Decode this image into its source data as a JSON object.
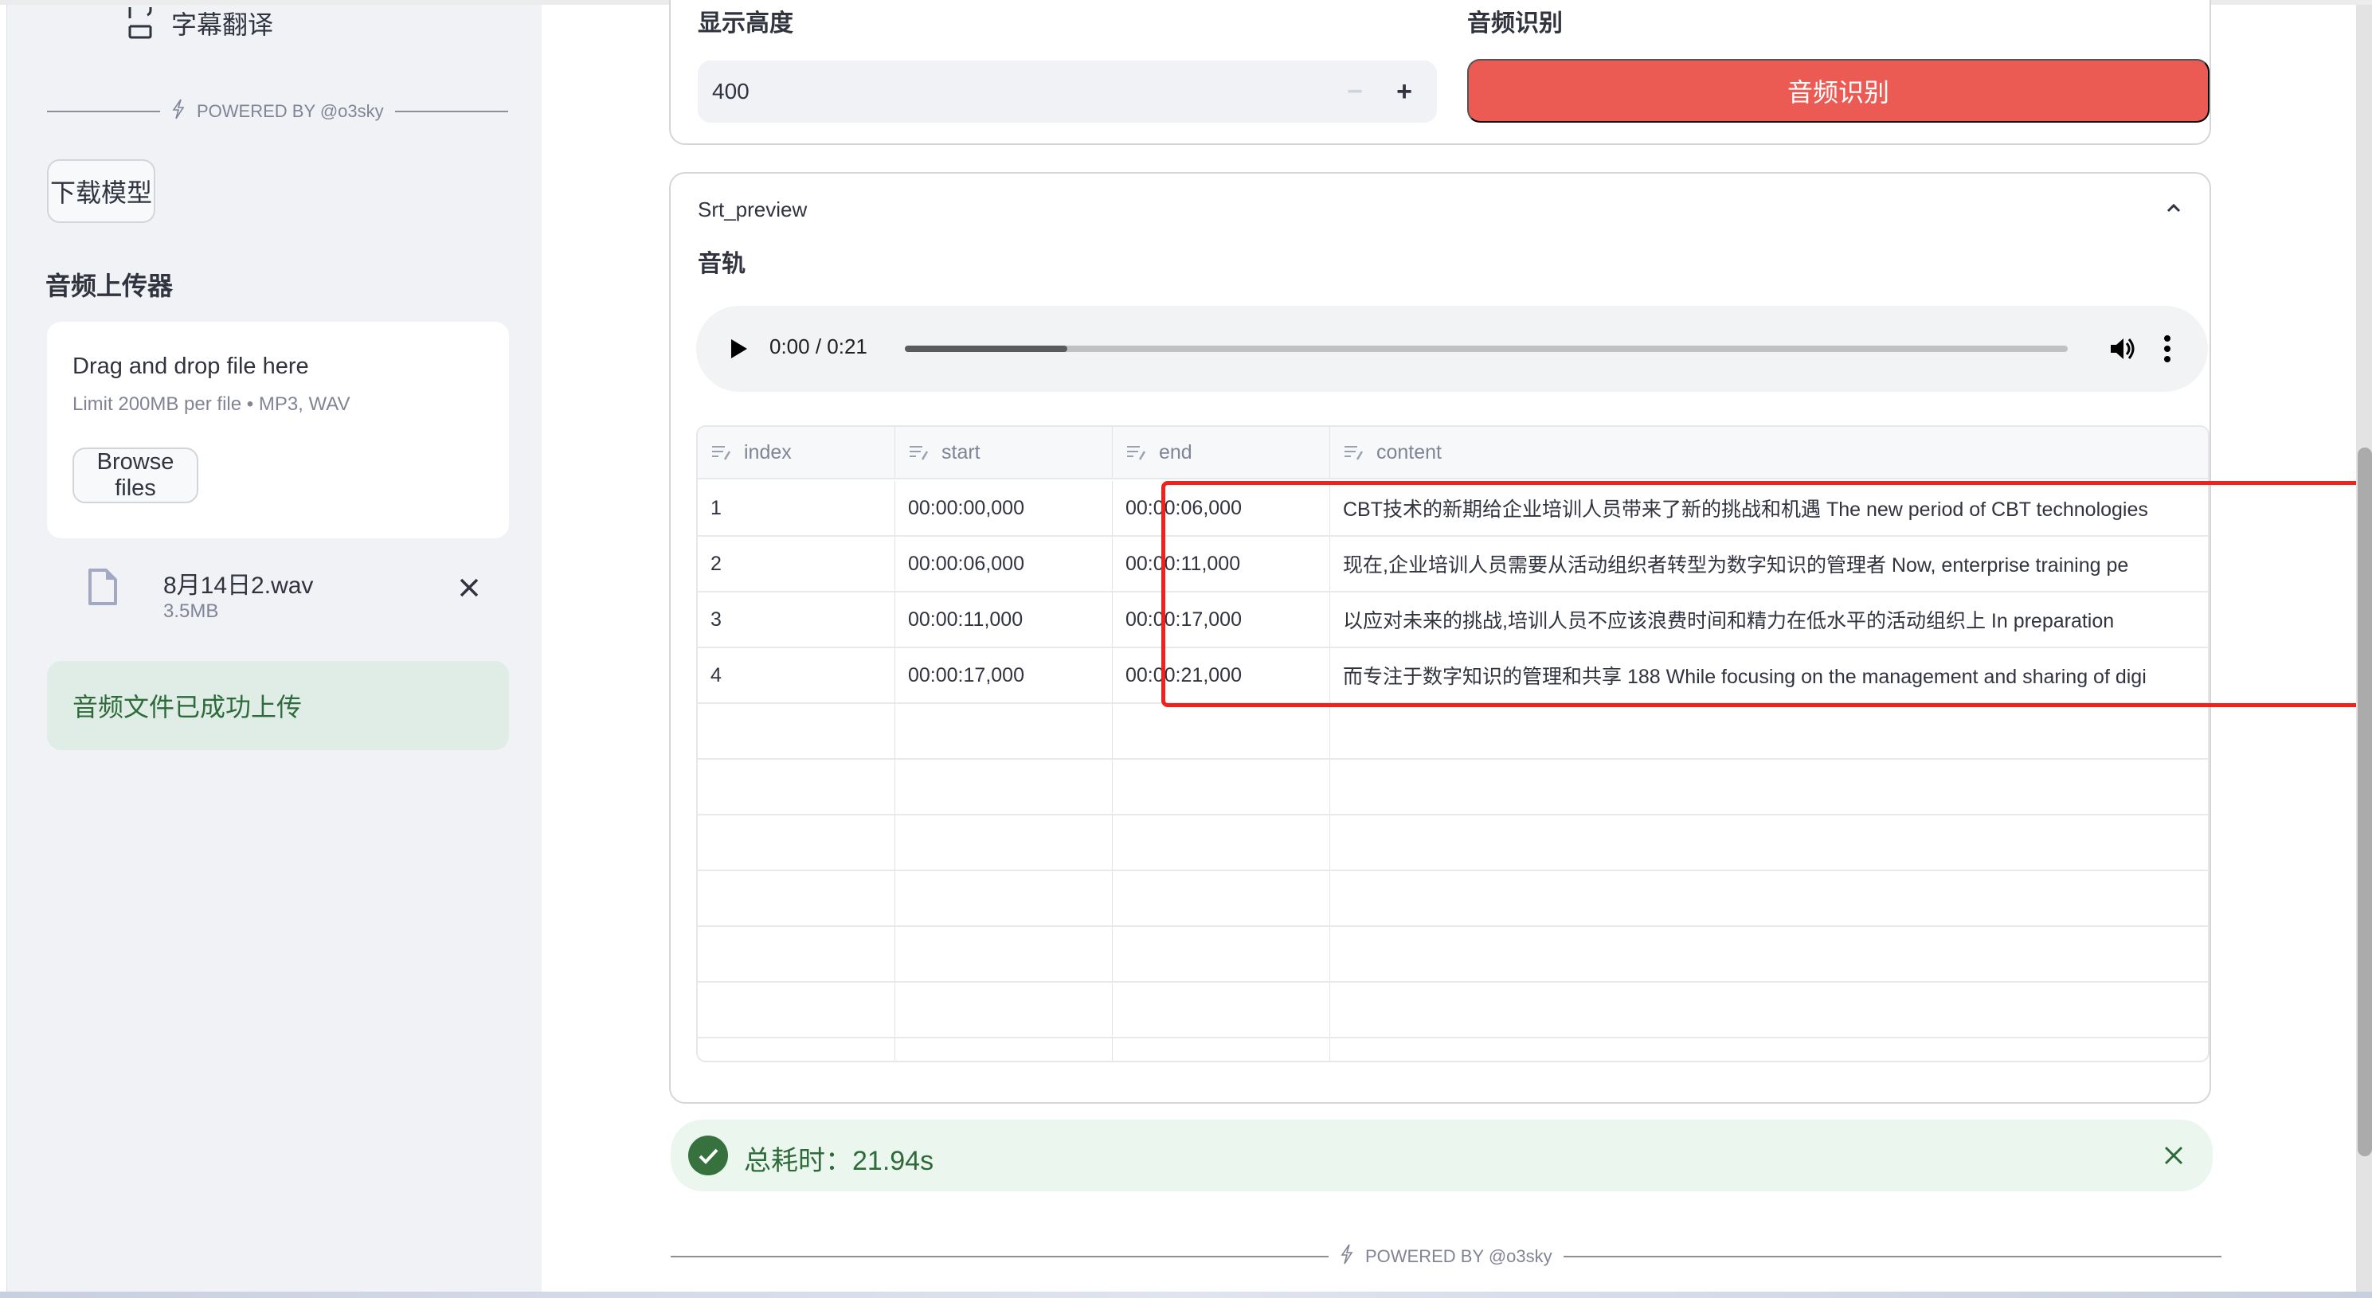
{
  "sidebar": {
    "nav_item_label": "字幕翻译",
    "powered_by": "POWERED BY @o3sky",
    "download_model_label": "下载模型",
    "uploader_heading": "音频上传器",
    "dropzone": {
      "title": "Drag and drop file here",
      "subtitle": "Limit 200MB per file • MP3, WAV",
      "browse_label": "Browse files"
    },
    "uploaded_file": {
      "name": "8月14日2.wav",
      "size": "3.5MB"
    },
    "success_message": "音频文件已成功上传"
  },
  "main": {
    "height_label": "显示高度",
    "height_value": "400",
    "recognize_label": "音频识别",
    "recognize_button": "音频识别",
    "accent_color": "#eb5b53",
    "expander_title": "Srt_preview",
    "audio_heading": "音轨",
    "audio": {
      "time": "0:00 / 0:21",
      "progress_fraction": 0.14
    },
    "table": {
      "columns": [
        "index",
        "start",
        "end",
        "content"
      ],
      "rows": [
        [
          "1",
          "00:00:00,000",
          "00:00:06,000",
          "CBT技术的新期给企业培训人员带来了新的挑战和机遇 The new period of CBT technologies"
        ],
        [
          "2",
          "00:00:06,000",
          "00:00:11,000",
          "现在,企业培训人员需要从活动组织者转型为数字知识的管理者 Now, enterprise training pe"
        ],
        [
          "3",
          "00:00:11,000",
          "00:00:17,000",
          "以应对未来的挑战,培训人员不应该浪费时间和精力在低水平的活动组织上 In preparation"
        ],
        [
          "4",
          "00:00:17,000",
          "00:00:21,000",
          "而专注于数字知识的管理和共享 188 While focusing on the management and sharing of digi"
        ]
      ],
      "empty_rows": 6
    },
    "toast": {
      "message": "总耗时：21.94s",
      "color": "#2f6b39"
    },
    "footer_powered_by": "POWERED BY @o3sky"
  }
}
